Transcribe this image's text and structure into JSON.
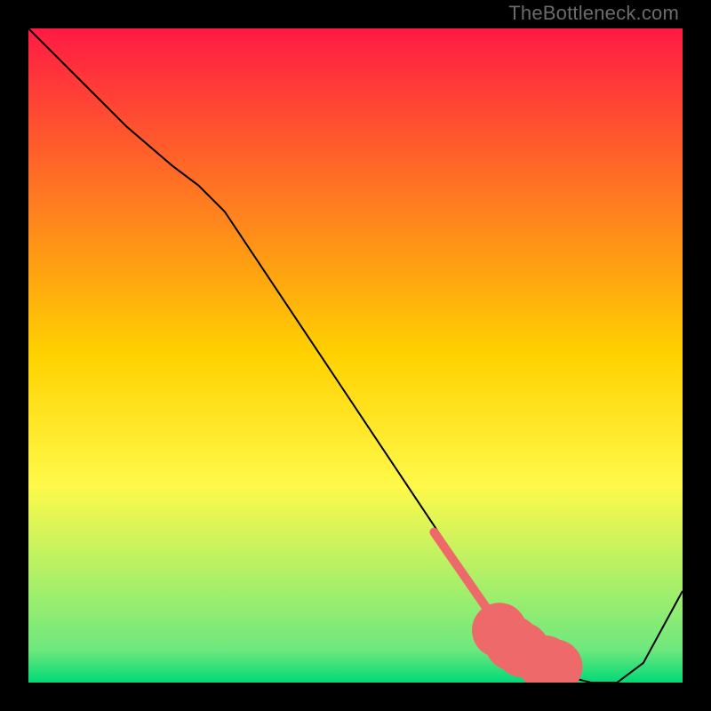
{
  "watermark": "TheBottleneck.com",
  "chart_data": {
    "type": "line",
    "title": "",
    "xlabel": "",
    "ylabel": "",
    "xlim": [
      0,
      100
    ],
    "ylim": [
      0,
      100
    ],
    "background_gradient": {
      "stops": [
        {
          "pos": 0,
          "color": "#ff1a44"
        },
        {
          "pos": 50,
          "color": "#ffd200"
        },
        {
          "pos": 70,
          "color": "#fff94a"
        },
        {
          "pos": 95,
          "color": "#6ee87e"
        },
        {
          "pos": 100,
          "color": "#00d977"
        }
      ]
    },
    "series": [
      {
        "name": "bottleneck_curve",
        "color": "#000000",
        "x": [
          0,
          8,
          15,
          22,
          26,
          30,
          38,
          46,
          54,
          60,
          66,
          70,
          74,
          78,
          82,
          86,
          90,
          94,
          100
        ],
        "values": [
          100,
          92,
          85,
          79,
          76,
          72,
          60,
          48,
          36,
          27,
          18,
          12,
          7,
          3,
          1,
          0,
          0,
          3,
          14
        ]
      }
    ],
    "highlights": {
      "name": "marker_segment",
      "color": "#ee6a6a",
      "bar": {
        "x0": 62,
        "y0": 23,
        "x1": 71,
        "y1": 10
      },
      "dots": [
        {
          "x": 72,
          "y": 8
        },
        {
          "x": 74,
          "y": 6
        },
        {
          "x": 75.5,
          "y": 5
        },
        {
          "x": 79,
          "y": 3
        },
        {
          "x": 80.5,
          "y": 2.4
        }
      ]
    }
  }
}
